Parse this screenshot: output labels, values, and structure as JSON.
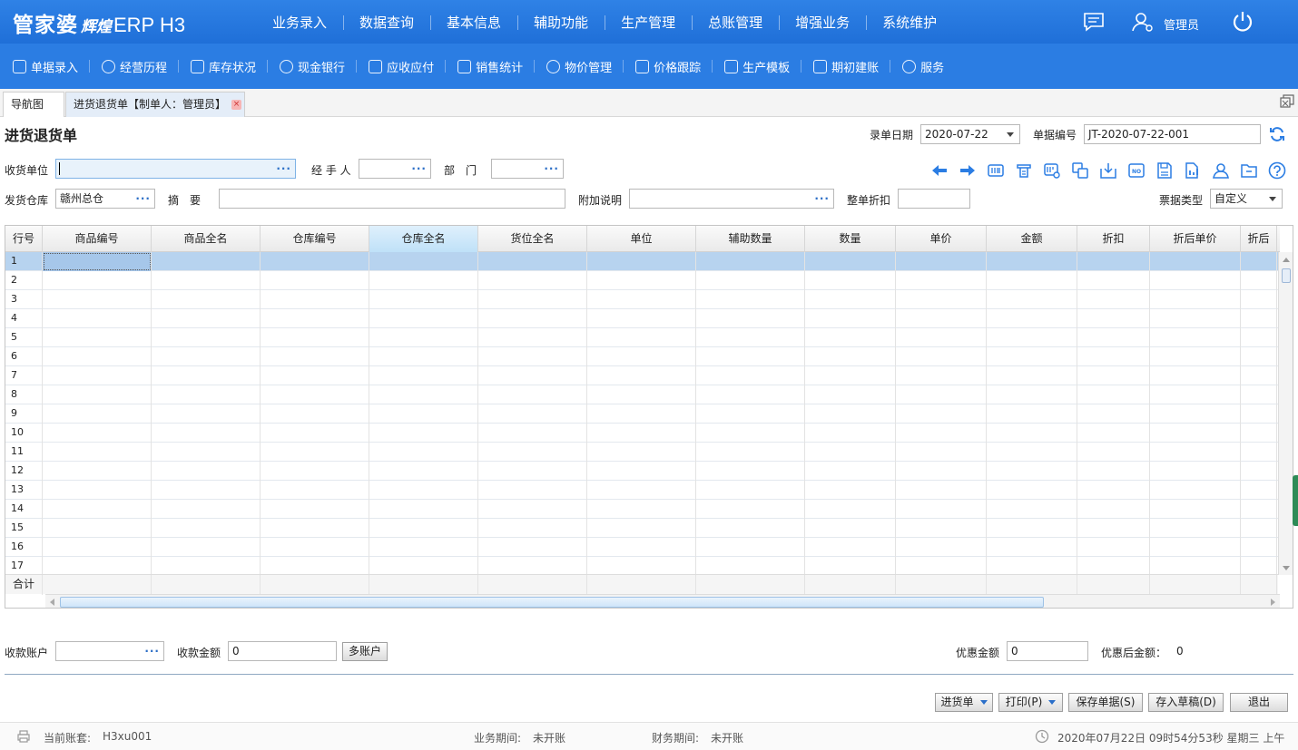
{
  "app": {
    "logo_main": "管家婆",
    "logo_brand": "辉煌",
    "logo_product": "ERP H3",
    "main_nav": [
      "业务录入",
      "数据查询",
      "基本信息",
      "辅助功能",
      "生产管理",
      "总账管理",
      "增强业务",
      "系统维护"
    ],
    "user_name": "管理员"
  },
  "toolbar": {
    "items": [
      {
        "label": "单据录入",
        "icon": "edit-icon"
      },
      {
        "label": "经营历程",
        "icon": "history-icon"
      },
      {
        "label": "库存状况",
        "icon": "warehouse-icon"
      },
      {
        "label": "现金银行",
        "icon": "yen-icon"
      },
      {
        "label": "应收应付",
        "icon": "ledger-icon"
      },
      {
        "label": "销售统计",
        "icon": "stats-icon"
      },
      {
        "label": "物价管理",
        "icon": "shield-icon"
      },
      {
        "label": "价格跟踪",
        "icon": "track-icon"
      },
      {
        "label": "生产模板",
        "icon": "template-icon"
      },
      {
        "label": "期初建账",
        "icon": "book-icon"
      },
      {
        "label": "服务",
        "icon": "help-icon"
      }
    ]
  },
  "tabs": {
    "nav_label": "导航图",
    "active_label": "进货退货单【制单人：管理员】",
    "close_symbol": "×"
  },
  "form": {
    "title": "进货退货单",
    "entry_date_label": "录单日期",
    "entry_date": "2020-07-22",
    "doc_no_label": "单据编号",
    "doc_no": "JT-2020-07-22-001",
    "receiver_label": "收货单位",
    "receiver_value": "",
    "handler_label": "经 手 人",
    "handler_value": "",
    "dept_label": "部　门",
    "dept_value": "",
    "warehouse_label": "发货仓库",
    "warehouse_value": "赣州总仓",
    "summary_label": "摘　要",
    "summary_value": "",
    "note_label": "附加说明",
    "note_value": "",
    "discount_label": "整单折扣",
    "discount_value": "",
    "ticket_type_label": "票据类型",
    "ticket_type_value": "自定义",
    "ellipsis": "···"
  },
  "grid": {
    "headers": [
      "行号",
      "商品编号",
      "商品全名",
      "仓库编号",
      "仓库全名",
      "货位全名",
      "单位",
      "辅助数量",
      "数量",
      "单价",
      "金额",
      "折扣",
      "折后单价",
      "折后"
    ],
    "rows": [
      "1",
      "2",
      "3",
      "4",
      "5",
      "6",
      "7",
      "8",
      "9",
      "10",
      "11",
      "12",
      "13",
      "14",
      "15",
      "16",
      "17"
    ],
    "total_label": "合计"
  },
  "payment": {
    "account_label": "收款账户",
    "account_value": "",
    "amount_label": "收款金额",
    "amount_value": "0",
    "multi_account_button": "多账户",
    "discount_amount_label": "优惠金额",
    "discount_amount_value": "0",
    "after_discount_label": "优惠后金额：",
    "after_discount_value": "0"
  },
  "actions": {
    "purchase_order": "进货单",
    "print": "打印(P)",
    "save": "保存单据(S)",
    "draft": "存入草稿(D)",
    "exit": "退出"
  },
  "status": {
    "account_label": "当前账套:",
    "account_value": "H3xu001",
    "biz_period_label": "业务期间:",
    "biz_period_value": "未开账",
    "fin_period_label": "财务期间:",
    "fin_period_value": "未开账",
    "datetime": "2020年07月22日 09时54分53秒 星期三 上午"
  }
}
